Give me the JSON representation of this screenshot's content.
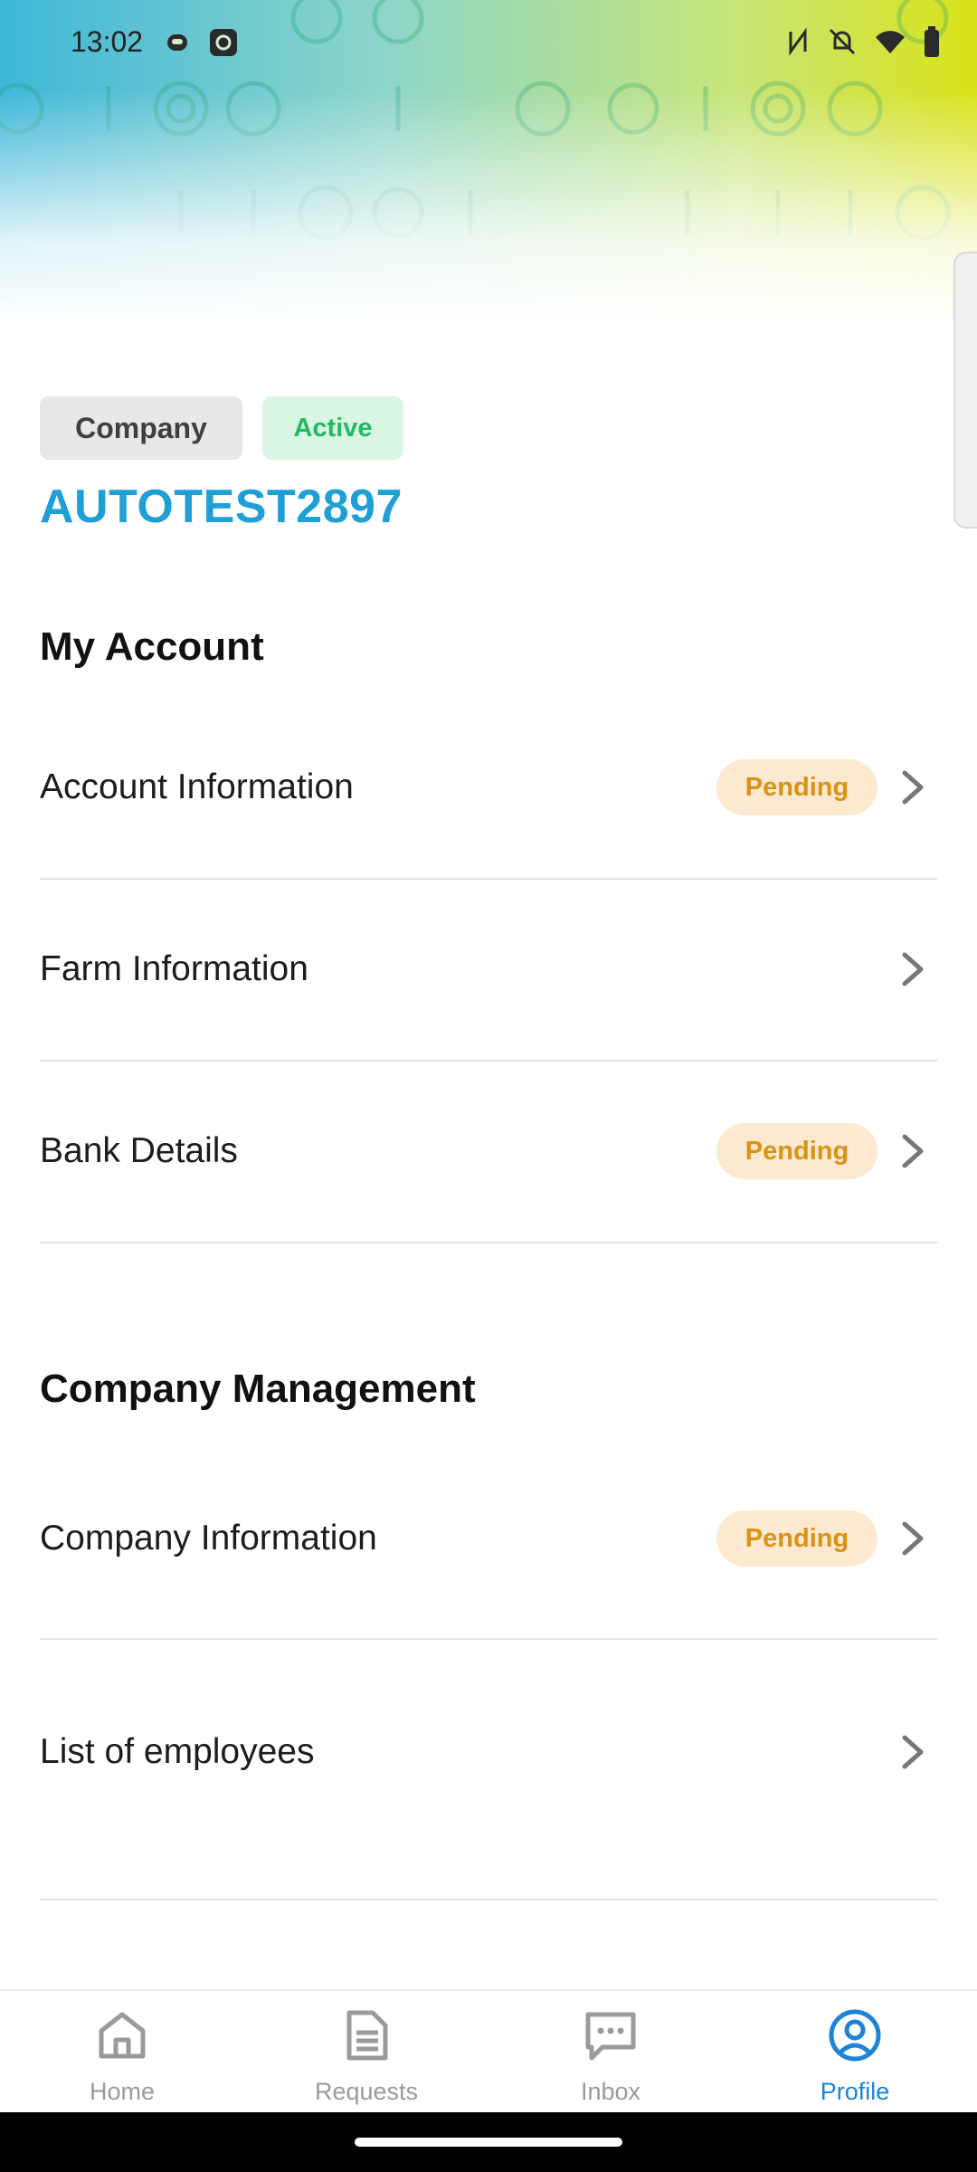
{
  "status": {
    "time": "13:02"
  },
  "company": {
    "type_badge": "Company",
    "status_badge": "Active",
    "name": "AUTOTEST2897"
  },
  "my_account": {
    "title": "My Account",
    "items": [
      {
        "label": "Account Information",
        "badge": "Pending"
      },
      {
        "label": "Farm Information",
        "badge": ""
      },
      {
        "label": "Bank Details",
        "badge": "Pending"
      }
    ]
  },
  "company_management": {
    "title": "Company Management",
    "items": [
      {
        "label": "Company Information",
        "badge": "Pending"
      },
      {
        "label": "List of employees",
        "badge": ""
      }
    ]
  },
  "nav": {
    "items": [
      {
        "label": "Home",
        "icon": "home-icon"
      },
      {
        "label": "Requests",
        "icon": "document-icon"
      },
      {
        "label": "Inbox",
        "icon": "chat-icon"
      },
      {
        "label": "Profile",
        "icon": "profile-icon"
      }
    ],
    "active": "Profile"
  },
  "colors": {
    "accent": "#1e9fd6",
    "active_green": "#24b864",
    "pending_text": "#d99212",
    "pending_bg": "#fde9cf",
    "nav_active": "#1b84d9"
  }
}
